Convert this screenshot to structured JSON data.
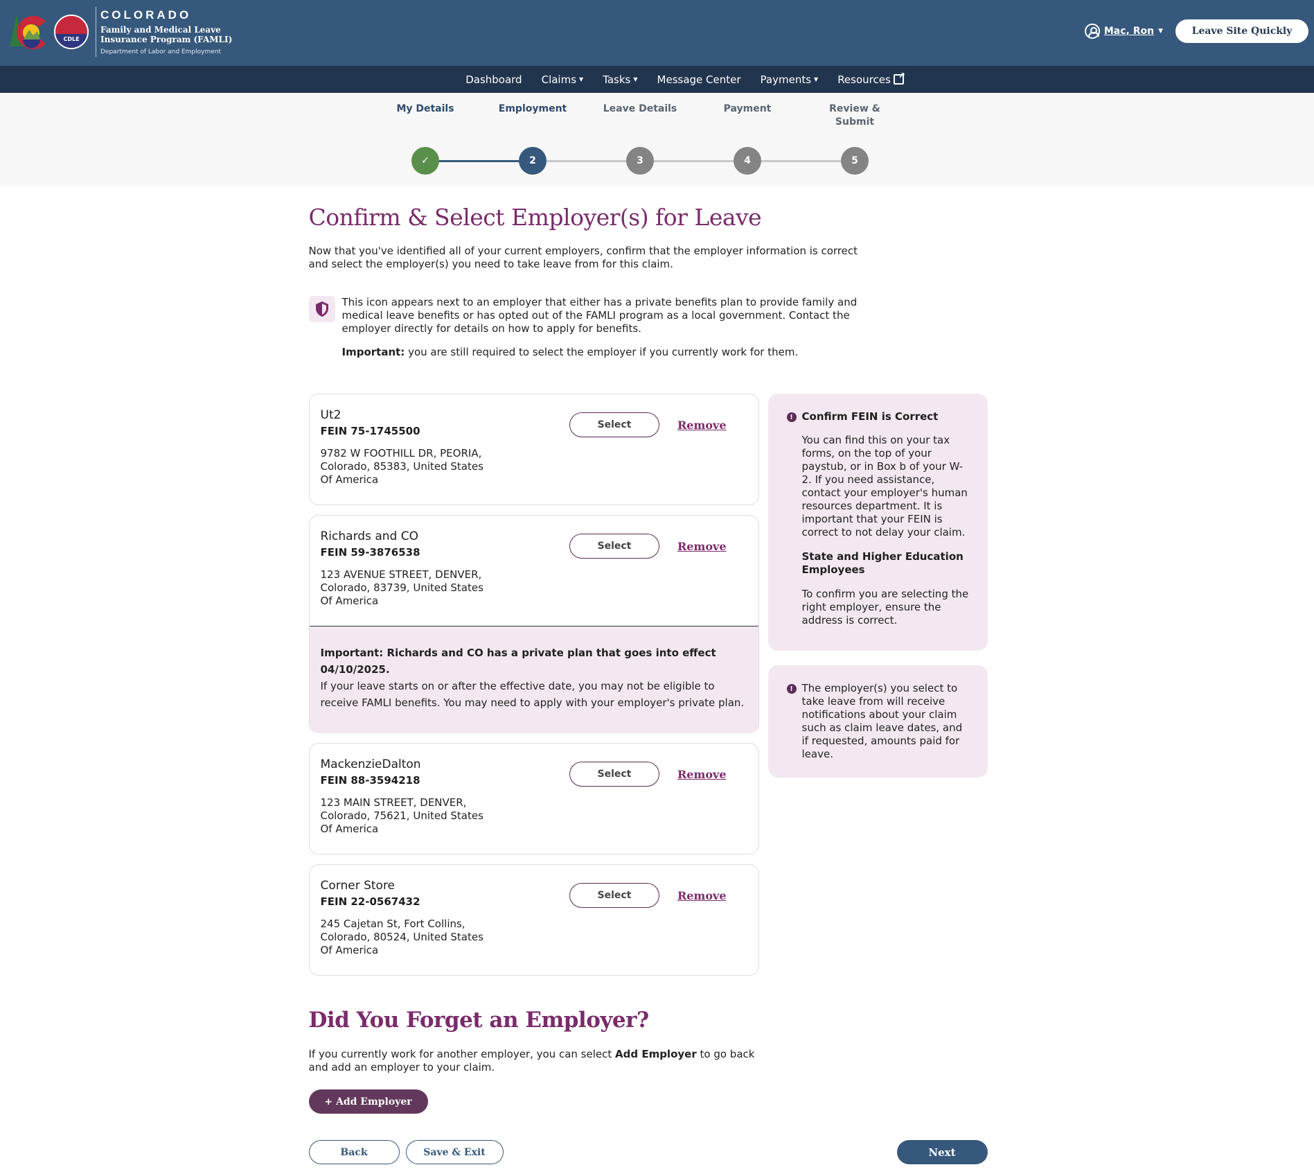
{
  "header": {
    "brand_title": "COLORADO",
    "brand_program_line1": "Family and Medical Leave",
    "brand_program_line2": "Insurance Program (FAMLI)",
    "brand_department": "Department of Labor and Employment",
    "cdle_badge": "CDLE",
    "user_name": "Mac, Ron",
    "leave_site_button": "Leave Site Quickly"
  },
  "nav": {
    "items": [
      {
        "label": "Dashboard",
        "dropdown": false
      },
      {
        "label": "Claims",
        "dropdown": true
      },
      {
        "label": "Tasks",
        "dropdown": true
      },
      {
        "label": "Message Center",
        "dropdown": false
      },
      {
        "label": "Payments",
        "dropdown": true
      },
      {
        "label": "Resources",
        "external": true
      }
    ]
  },
  "stepper": {
    "steps": [
      {
        "label": "My Details",
        "number": "1",
        "status": "complete"
      },
      {
        "label": "Employment",
        "number": "2",
        "status": "active"
      },
      {
        "label": "Leave Details",
        "number": "3",
        "status": "todo"
      },
      {
        "label": "Payment",
        "number": "4",
        "status": "todo"
      },
      {
        "label": "Review & Submit",
        "number": "5",
        "status": "todo"
      }
    ],
    "check_glyph": "✓"
  },
  "main": {
    "title": "Confirm & Select Employer(s) for Leave",
    "intro": "Now that you've identified all of your current employers, confirm that the employer information is correct and select the employer(s) you need to take leave from for this claim.",
    "shield_note": "This icon appears next to an employer that either has a private benefits plan to provide family and medical leave benefits or has opted out of the FAMLI program as a local government. Contact the employer directly for details on how to apply for benefits.",
    "important_label": "Important:",
    "important_text": " you are still required to select the employer if you currently work for them."
  },
  "employers": [
    {
      "name": "Ut2",
      "fein": "FEIN 75-1745500",
      "address": "9782 W FOOTHILL DR, PEORIA, Colorado, 85383, United States Of America",
      "select_label": "Select",
      "remove_label": "Remove"
    },
    {
      "name": "Richards and CO",
      "fein": "FEIN 59-3876538",
      "address": "123 AVENUE STREET, DENVER, Colorado, 83739, United States Of America",
      "select_label": "Select",
      "remove_label": "Remove",
      "plan_notice_bold": "Important: Richards and CO has a private plan that goes into effect 04/10/2025.",
      "plan_notice_text": "If your leave starts on or after the effective date, you may not be eligible to receive FAMLI benefits. You may need to apply with your employer's private plan."
    },
    {
      "name": "MackenzieDalton",
      "fein": "FEIN 88-3594218",
      "address": "123 MAIN STREET, DENVER, Colorado, 75621, United States Of America",
      "select_label": "Select",
      "remove_label": "Remove"
    },
    {
      "name": "Corner Store",
      "fein": "FEIN 22-0567432",
      "address": "245 Cajetan St, Fort Collins, Colorado, 80524, United States Of America",
      "select_label": "Select",
      "remove_label": "Remove"
    }
  ],
  "sidebar": {
    "fein_title": "Confirm FEIN is Correct",
    "fein_text": "You can find this on your tax forms, on the top of your paystub, or in Box b of your W-2. If you need assistance, contact your employer's human resources department. It is important that your FEIN is correct to not delay your claim.",
    "state_title": "State and Higher Education Employees",
    "state_text": "To confirm you are selecting the right employer, ensure the address is correct.",
    "notify_text": "The employer(s) you select to take leave from will receive notifications about your claim such as claim leave dates, and if requested, amounts paid for leave."
  },
  "forgot": {
    "title": "Did You Forget an Employer?",
    "text_before": "If you currently work for another employer, you can select ",
    "text_bold": "Add Employer",
    "text_after": " to go back and add an employer to your claim.",
    "add_button": "+ Add Employer"
  },
  "footer": {
    "back": "Back",
    "save_exit": "Save & Exit",
    "next": "Next"
  },
  "colors": {
    "header_bg": "#36587c",
    "nav_bg": "#22354f",
    "accent_purple": "#7a2b6b",
    "step_complete": "#5a8f4b",
    "step_todo": "#848484",
    "panel_pink": "#f3e8f1"
  }
}
